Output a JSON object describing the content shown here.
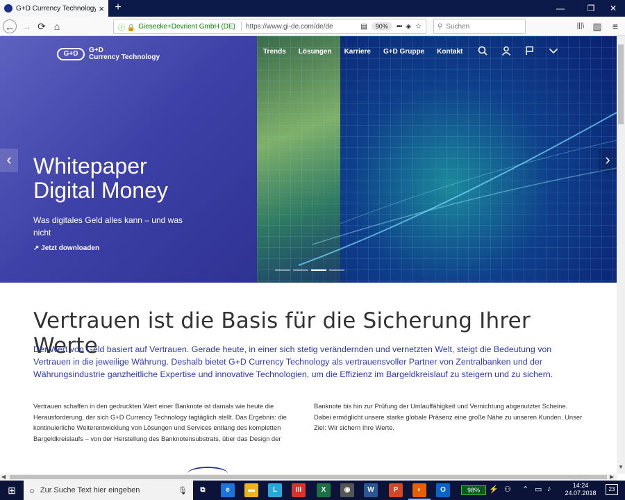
{
  "browser": {
    "tab_title": "G+D Currency Technology | G+",
    "favicon_text": "G+D",
    "new_tab_label": "+",
    "site_identity": "Giesecke+Devrient GmbH (DE)",
    "url": "https://www.gi-de.com/de/de",
    "zoom": "90%",
    "search_placeholder": "Suchen",
    "win_min": "—",
    "win_max": "❐",
    "win_close": "✕",
    "back": "←",
    "forward": "→",
    "reload": "⟳",
    "home": "⌂",
    "more": "•••",
    "bookmark": "☆",
    "reader": "▤",
    "pocket": "◈",
    "library": "|||\\",
    "sidebar": "▥",
    "menu": "≡"
  },
  "site": {
    "logo_mark": "G+D",
    "logo_line1": "G+D",
    "logo_line2": "Currency Technology",
    "nav": [
      "Trends",
      "Lösungen",
      "Karriere",
      "G+D Gruppe",
      "Kontakt"
    ],
    "icons": [
      "search-icon",
      "user-icon",
      "flag-icon",
      "chevron-down-icon"
    ]
  },
  "hero": {
    "title_line1": "Whitepaper",
    "title_line2": "Digital Money",
    "subtitle": "Was digitales Geld alles kann – und was nicht",
    "link": "↗  Jetzt downloaden",
    "prev": "‹",
    "next": "›"
  },
  "content": {
    "heading": "Vertrauen ist die Basis für die Sicherung Ihrer Werte",
    "lead": "Der Wert von Geld basiert auf Vertrauen. Gerade heute, in einer sich stetig verändernden und vernetzten Welt, steigt die Bedeutung von Vertrauen in die jeweilige Währung. Deshalb bietet G+D Currency Technology als vertrauensvoller Partner von Zentralbanken und der Währungsindustrie ganzheitliche Expertise und innovative Technologien, um die Effizienz im Bargeldkreislauf zu steigern und zu sichern.",
    "col1": "Vertrauen schaffen in den gedruckten Wert einer Banknote ist damals wie heute die Herausforderung, der sich G+D Currency Technology tagtäglich stellt. Das Ergebnis: die kontinuierliche Weiterentwicklung von Lösungen und Services entlang des kompletten Bargeldkreislaufs – von der Herstellung des Banknotensubstrats, über das Design der",
    "col2": "Banknote bis hin zur Prüfung der Umlauffähigkeit und Vernichtung abgenutzter Scheine. Dabei ermöglicht unsere starke globale Präsenz eine große Nähe zu unseren Kunden. Unser Ziel: Wir sichern Ihre Werte."
  },
  "taskbar": {
    "search_placeholder": "Zur Suche Text hier eingeben",
    "battery": "98%",
    "time": "14:24",
    "date": "24.07.2018",
    "notifications": "23",
    "apps": [
      {
        "name": "task-view",
        "glyph": "⧉",
        "color": "#0b1338"
      },
      {
        "name": "edge",
        "glyph": "e",
        "color": "#1e73d6"
      },
      {
        "name": "explorer",
        "glyph": "▬",
        "color": "#e8b422"
      },
      {
        "name": "app-l",
        "glyph": "L",
        "color": "#2aa7d9"
      },
      {
        "name": "app-red",
        "glyph": "III",
        "color": "#d9342b"
      },
      {
        "name": "excel",
        "glyph": "X",
        "color": "#1d7044"
      },
      {
        "name": "app-photo",
        "glyph": "◉",
        "color": "#555"
      },
      {
        "name": "word",
        "glyph": "W",
        "color": "#2b5797"
      },
      {
        "name": "powerpoint",
        "glyph": "P",
        "color": "#d24726"
      },
      {
        "name": "firefox",
        "glyph": "◐",
        "color": "#e66000"
      },
      {
        "name": "outlook",
        "glyph": "O",
        "color": "#0a64c8"
      }
    ]
  },
  "colors": {
    "lead_blue": "#2e3ab0",
    "hero_blue": "#3b3fa5",
    "taskbar": "#0b1338"
  }
}
